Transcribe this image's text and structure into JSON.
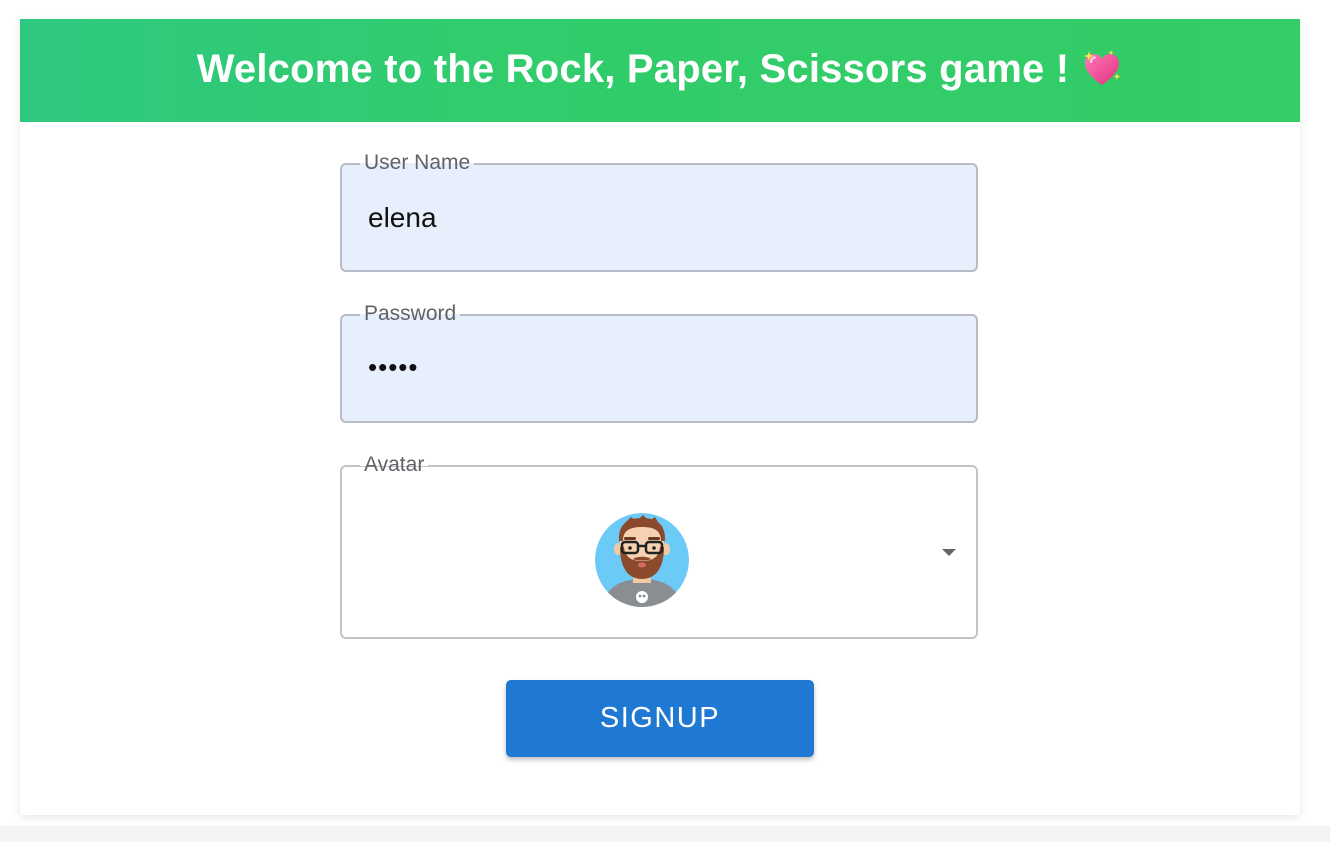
{
  "header": {
    "title": "Welcome to the Rock, Paper, Scissors game !",
    "title_icon": "sparkling-heart-icon",
    "background_color": "#31cc6b"
  },
  "form": {
    "username": {
      "label": "User Name",
      "value": "elena"
    },
    "password": {
      "label": "Password",
      "masked_value": "•••••"
    },
    "avatar": {
      "label": "Avatar",
      "selected_icon": "bearded-man-glasses-avatar",
      "dropdown_icon": "caret-down-icon"
    },
    "submit": {
      "label": "SIGNUP",
      "color": "#1f78d1"
    }
  }
}
